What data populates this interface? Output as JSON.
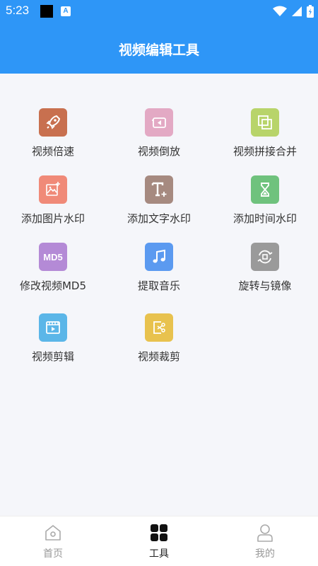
{
  "status_bar": {
    "time": "5:23",
    "badge": "A"
  },
  "header": {
    "title": "视频编辑工具"
  },
  "tools": [
    {
      "label": "视频倍速",
      "color": "#c8704f",
      "icon": "rocket-icon"
    },
    {
      "label": "视频倒放",
      "color": "#e3a9c4",
      "icon": "rewind-play-icon"
    },
    {
      "label": "视频拼接合并",
      "color": "#b8d46a",
      "icon": "merge-squares-icon"
    },
    {
      "label": "添加图片水印",
      "color": "#f08a78",
      "icon": "image-add-icon"
    },
    {
      "label": "添加文字水印",
      "color": "#a68a80",
      "icon": "text-add-icon"
    },
    {
      "label": "添加时间水印",
      "color": "#6fc27d",
      "icon": "hourglass-icon"
    },
    {
      "label": "修改视频MD5",
      "color": "#b48ad6",
      "icon": "md5-icon",
      "icon_text": "MD5"
    },
    {
      "label": "提取音乐",
      "color": "#5b9af0",
      "icon": "music-note-icon"
    },
    {
      "label": "旋转与镜像",
      "color": "#9a9a9a",
      "icon": "rotate-icon"
    },
    {
      "label": "视频剪辑",
      "color": "#5bb6e8",
      "icon": "film-clip-icon"
    },
    {
      "label": "视频裁剪",
      "color": "#e8c24e",
      "icon": "crop-scissors-icon"
    }
  ],
  "bottom_nav": {
    "items": [
      {
        "label": "首页",
        "active": false
      },
      {
        "label": "工具",
        "active": true
      },
      {
        "label": "我的",
        "active": false
      }
    ]
  }
}
